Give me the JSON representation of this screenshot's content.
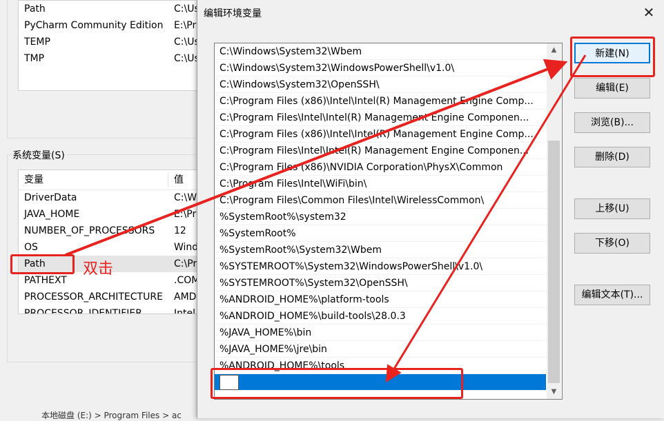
{
  "background": {
    "user_vars": [
      {
        "name": "Path",
        "value": "C:\\Us"
      },
      {
        "name": "PyCharm Community Edition",
        "value": "E:\\Pr"
      },
      {
        "name": "TEMP",
        "value": "C:\\Us"
      },
      {
        "name": "TMP",
        "value": "C:\\Us"
      }
    ],
    "system_vars_label": "系统变量(S)",
    "system_vars_label_underline": "S",
    "columns": {
      "name": "变量",
      "value": "值"
    },
    "system_vars": [
      {
        "name": "DriverData",
        "value": "C:\\W"
      },
      {
        "name": "JAVA_HOME",
        "value": "E:\\Pr"
      },
      {
        "name": "NUMBER_OF_PROCESSORS",
        "value": "12"
      },
      {
        "name": "OS",
        "value": "Wind"
      },
      {
        "name": "Path",
        "value": "C:\\Pr"
      },
      {
        "name": "PATHEXT",
        "value": ".COM"
      },
      {
        "name": "PROCESSOR_ARCHITECTURE",
        "value": "AMD"
      },
      {
        "name": "PROCESSOR_IDENTIFIER",
        "value": "Intel"
      }
    ],
    "status_text": "本地磁盘 (E:)  >  Program Files  >  ac"
  },
  "dialog": {
    "title": "编辑环境变量",
    "close_glyph": "✕",
    "paths": [
      "C:\\Windows\\System32\\Wbem",
      "C:\\Windows\\System32\\WindowsPowerShell\\v1.0\\",
      "C:\\Windows\\System32\\OpenSSH\\",
      "C:\\Program Files (x86)\\Intel\\Intel(R) Management Engine Comp...",
      "C:\\Program Files\\Intel\\Intel(R) Management Engine Componen...",
      "C:\\Program Files (x86)\\Intel\\Intel(R) Management Engine Comp...",
      "C:\\Program Files\\Intel\\Intel(R) Management Engine Componen...",
      "C:\\Program Files (x86)\\NVIDIA Corporation\\PhysX\\Common",
      "C:\\Program Files\\Intel\\WiFi\\bin\\",
      "C:\\Program Files\\Common Files\\Intel\\WirelessCommon\\",
      "%SystemRoot%\\system32",
      "%SystemRoot%",
      "%SystemRoot%\\System32\\Wbem",
      "%SYSTEMROOT%\\System32\\WindowsPowerShell\\v1.0\\",
      "%SYSTEMROOT%\\System32\\OpenSSH\\",
      "%ANDROID_HOME%\\platform-tools",
      "%ANDROID_HOME%\\build-tools\\28.0.3",
      "%JAVA_HOME%\\bin",
      "%JAVA_HOME%\\jre\\bin",
      "%ANDROID_HOME%\\tools"
    ],
    "new_entry_value": "",
    "buttons": {
      "new": "新建(N)",
      "edit": "编辑(E)",
      "browse": "浏览(B)...",
      "delete": "删除(D)",
      "move_up": "上移(U)",
      "move_down": "下移(O)",
      "edit_text": "编辑文本(T)..."
    },
    "scroll_up_glyph": "▲",
    "scroll_down_glyph": "▼"
  },
  "annotation": {
    "double_click_label": "双击",
    "color": "#e8231f"
  }
}
